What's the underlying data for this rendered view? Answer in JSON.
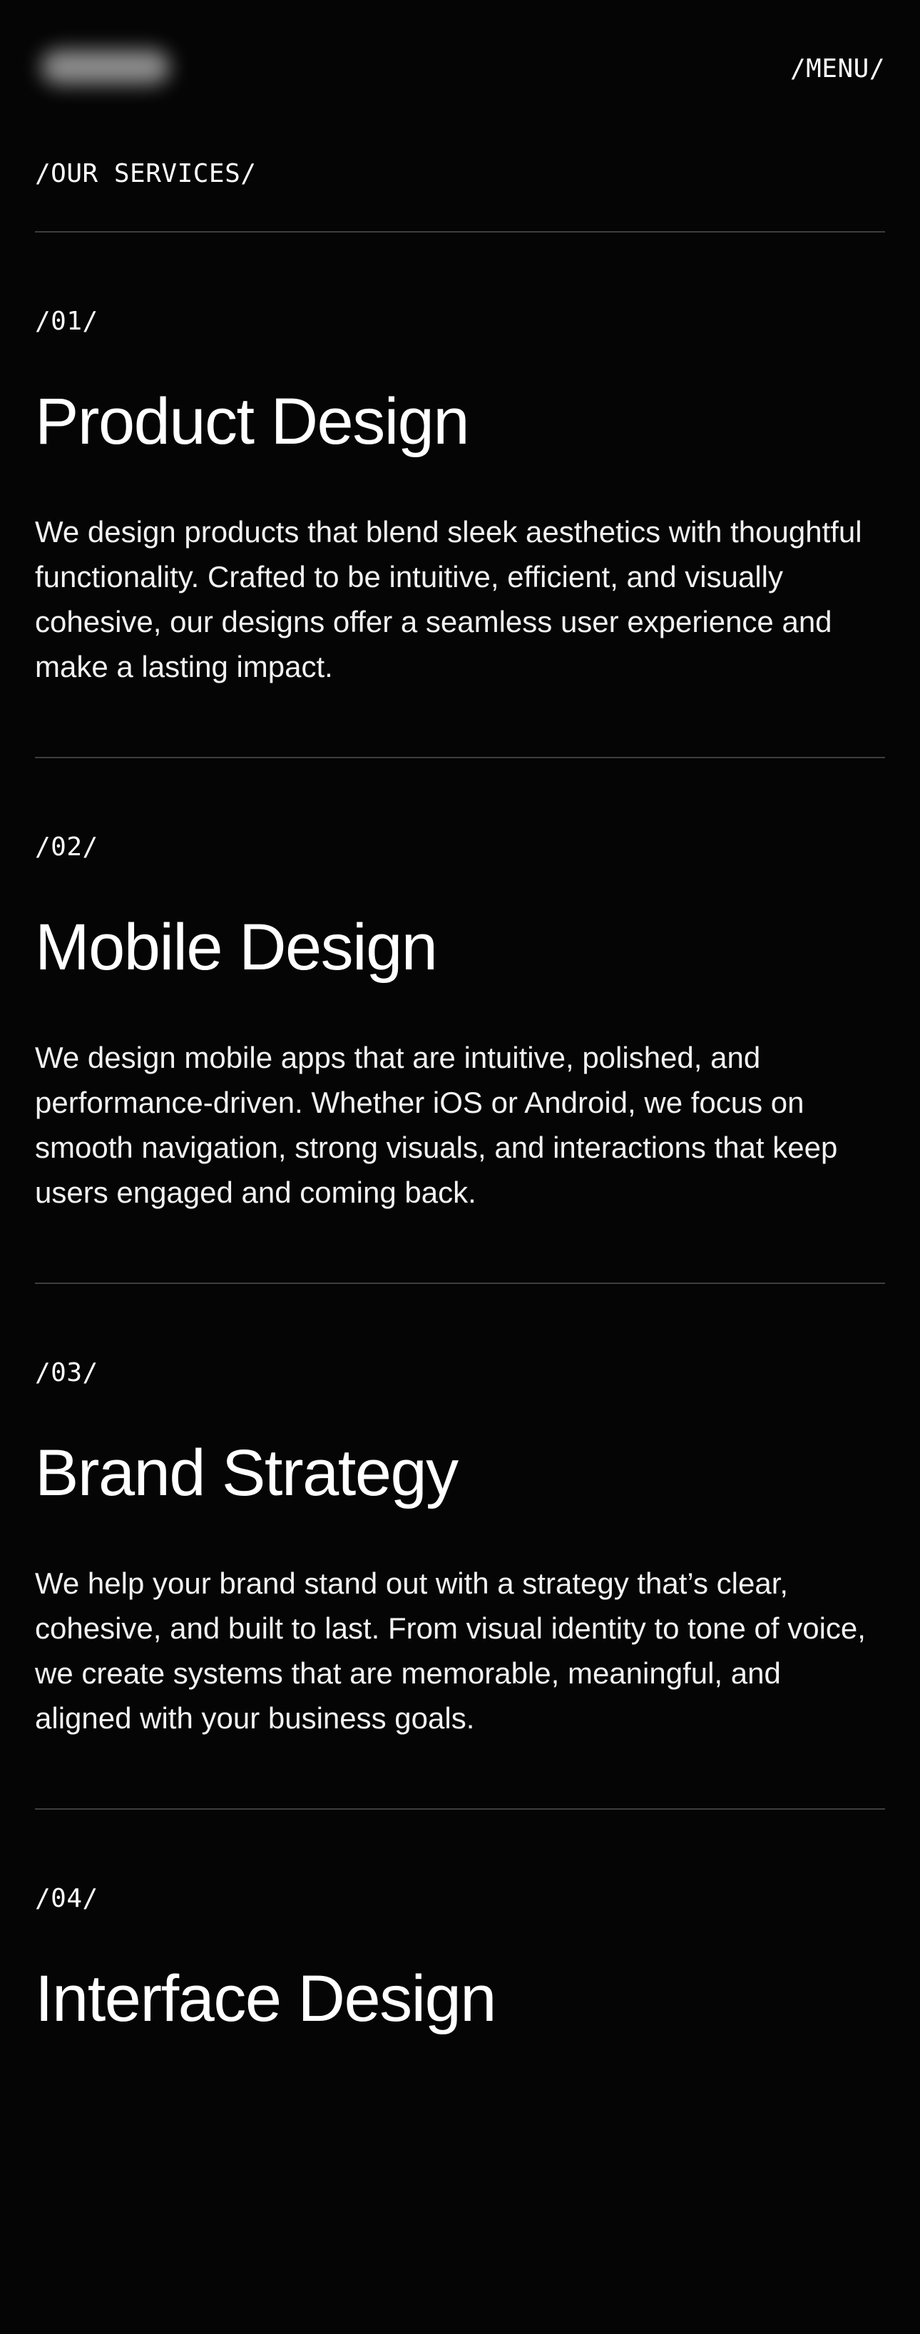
{
  "header": {
    "menu_label": "/MENU/"
  },
  "section": {
    "label": "/OUR SERVICES/"
  },
  "services": [
    {
      "number": "/01/",
      "title": "Product Design",
      "description": "We design products that blend sleek aesthetics with thoughtful functionality. Crafted to be intuitive, efficient, and visually cohesive, our designs offer a seamless user experience and make a lasting impact."
    },
    {
      "number": "/02/",
      "title": "Mobile Design",
      "description": "We design mobile apps that are intuitive, polished, and performance-driven. Whether iOS or Android, we focus on smooth navigation, strong visuals, and interactions that keep users engaged and coming back."
    },
    {
      "number": "/03/",
      "title": "Brand Strategy",
      "description": "We help your brand stand out with a strategy that’s clear, cohesive, and built to last. From visual identity to tone of voice, we create systems that are memorable, meaningful, and aligned with your business goals."
    },
    {
      "number": "/04/",
      "title": "Interface Design",
      "description": ""
    }
  ]
}
